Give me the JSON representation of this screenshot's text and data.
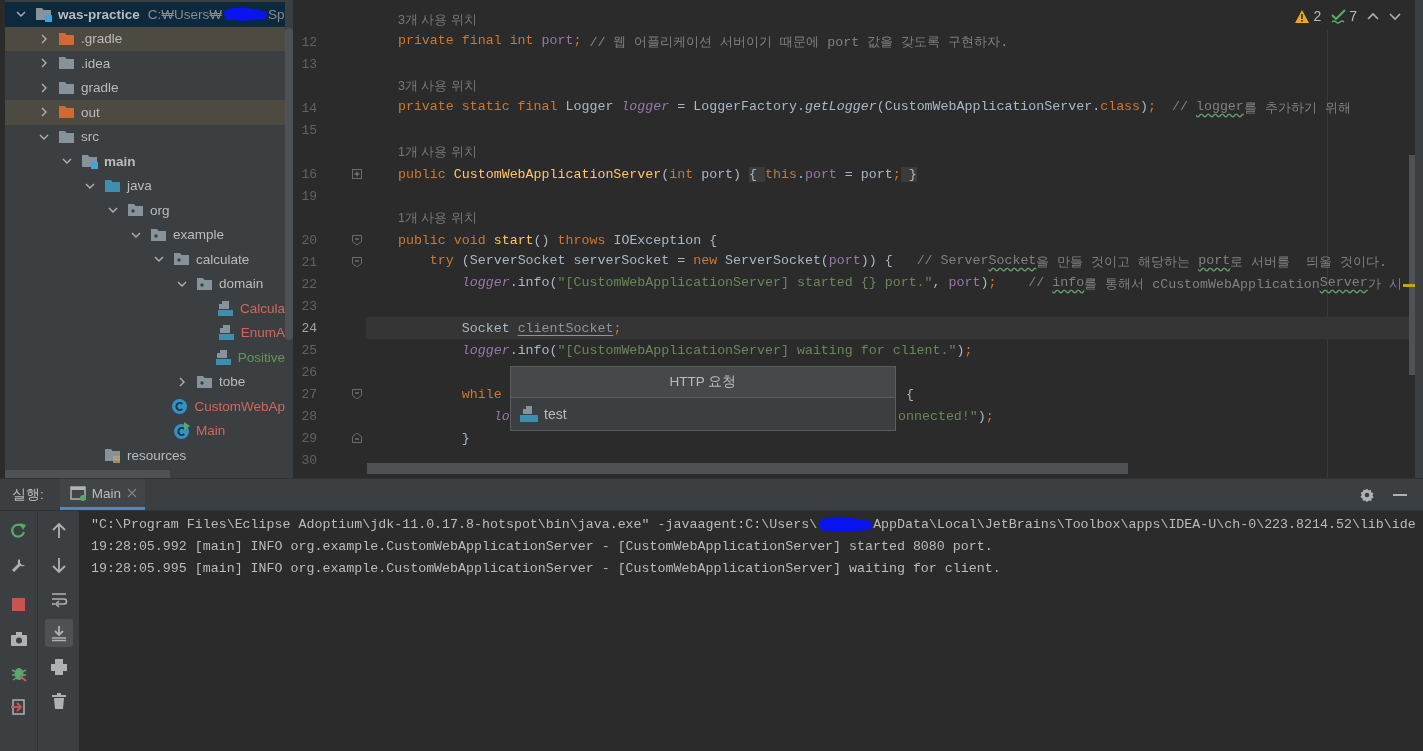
{
  "project_tree": {
    "root": {
      "name": "was-practice",
      "path": "C:₩Users₩",
      "redacted": true,
      "path_end": "Sp",
      "kind": "module",
      "expanded": true,
      "selected": true,
      "children": [
        {
          "name": ".gradle",
          "kind": "excluded-folder",
          "expanded": false,
          "selected": false
        },
        {
          "name": ".idea",
          "kind": "folder",
          "expanded": false,
          "selected": false
        },
        {
          "name": "gradle",
          "kind": "folder",
          "expanded": false,
          "selected": false
        },
        {
          "name": "out",
          "kind": "excluded-folder",
          "expanded": false,
          "selected": false
        },
        {
          "name": "src",
          "kind": "folder",
          "expanded": true,
          "selected": false,
          "children": [
            {
              "name": "main",
              "kind": "module-folder",
              "expanded": true,
              "selected": false,
              "children": [
                {
                  "name": "java",
                  "kind": "source-root",
                  "expanded": true,
                  "selected": false,
                  "children": [
                    {
                      "name": "org",
                      "kind": "package",
                      "expanded": true,
                      "selected": false,
                      "children": [
                        {
                          "name": "example",
                          "kind": "package",
                          "expanded": true,
                          "selected": false,
                          "children": [
                            {
                              "name": "calculate",
                              "kind": "package",
                              "expanded": true,
                              "selected": false,
                              "children": [
                                {
                                  "name": "domain",
                                  "kind": "package",
                                  "expanded": true,
                                  "selected": false,
                                  "children": [
                                    {
                                      "name": "Calcula",
                                      "kind": "java-file",
                                      "color": "#d1675a",
                                      "selected": false
                                    },
                                    {
                                      "name": "EnumA",
                                      "kind": "java-file",
                                      "color": "#d1675a",
                                      "selected": false
                                    },
                                    {
                                      "name": "Positive",
                                      "kind": "java-file",
                                      "color": "#629755",
                                      "selected": false
                                    }
                                  ]
                                },
                                {
                                  "name": "tobe",
                                  "kind": "package",
                                  "expanded": false,
                                  "selected": false
                                }
                              ]
                            },
                            {
                              "name": "CustomWebAp",
                              "kind": "class",
                              "color": "#d1675a",
                              "selected": false
                            },
                            {
                              "name": "Main",
                              "kind": "main-class",
                              "color": "#d1675a",
                              "selected": false
                            }
                          ]
                        }
                      ]
                    }
                  ]
                },
                {
                  "name": "resources",
                  "kind": "resources-root",
                  "selected": false
                }
              ]
            }
          ]
        }
      ]
    }
  },
  "editor": {
    "inspections": [
      {
        "kind": "warning",
        "count": "2"
      },
      {
        "kind": "typo",
        "count": "7"
      }
    ],
    "rows": [
      {
        "kind": "hint",
        "text": "    3개 사용 위치"
      },
      {
        "kind": "code",
        "number": "12",
        "current": false,
        "tokens": [
          {
            "kind": "kw",
            "text": "    private final int "
          },
          {
            "kind": "field",
            "text": "port"
          },
          {
            "kind": "kw",
            "text": ";"
          },
          {
            "kind": "comment",
            "text": " // 웹 어플리케이션 서버이기 때문에 port 값을 갖도록 구현하자."
          }
        ]
      },
      {
        "kind": "code",
        "number": "13",
        "current": false,
        "tokens": []
      },
      {
        "kind": "hint",
        "text": "    3개 사용 위치"
      },
      {
        "kind": "code",
        "number": "14",
        "current": false,
        "tokens": [
          {
            "kind": "kw",
            "text": "    private static final "
          },
          {
            "kind": "plain",
            "text": "Logger "
          },
          {
            "kind": "static",
            "text": "logger"
          },
          {
            "kind": "plain",
            "text": " = LoggerFactory."
          },
          {
            "kind": "static-method",
            "text": "getLogger"
          },
          {
            "kind": "plain",
            "text": "(CustomWebApplicationServer."
          },
          {
            "kind": "kw",
            "text": "class"
          },
          {
            "kind": "plain",
            "text": ")"
          },
          {
            "kind": "kw",
            "text": ";"
          },
          {
            "kind": "comment",
            "text": "  // "
          },
          {
            "kind": "typo",
            "text": "logger"
          },
          {
            "kind": "comment",
            "text": "를 추가하기 위해"
          }
        ]
      },
      {
        "kind": "code",
        "number": "15",
        "current": false,
        "tokens": []
      },
      {
        "kind": "hint",
        "text": "    1개 사용 위치"
      },
      {
        "kind": "code",
        "number": "16",
        "current": false,
        "fold": {
          "kind": "collapsed"
        },
        "tokens": [
          {
            "kind": "kw",
            "text": "    public "
          },
          {
            "kind": "method",
            "text": "CustomWebApplicationServer"
          },
          {
            "kind": "plain",
            "text": "("
          },
          {
            "kind": "kw",
            "text": "int"
          },
          {
            "kind": "plain",
            "text": " port) "
          },
          {
            "kind": "folded",
            "text": "{ "
          },
          {
            "kind": "kw",
            "text": "this"
          },
          {
            "kind": "plain",
            "text": "."
          },
          {
            "kind": "field",
            "text": "port"
          },
          {
            "kind": "plain",
            "text": " = port"
          },
          {
            "kind": "kw",
            "text": ";"
          },
          {
            "kind": "folded",
            "text": " }"
          }
        ]
      },
      {
        "kind": "code",
        "number": "19",
        "current": false,
        "tokens": []
      },
      {
        "kind": "hint",
        "text": "    1개 사용 위치"
      },
      {
        "kind": "code",
        "number": "20",
        "current": false,
        "fold": {
          "kind": "start"
        },
        "tokens": [
          {
            "kind": "kw",
            "text": "    public void "
          },
          {
            "kind": "method",
            "text": "start"
          },
          {
            "kind": "plain",
            "text": "() "
          },
          {
            "kind": "kw",
            "text": "throws"
          },
          {
            "kind": "plain",
            "text": " IOException {"
          }
        ]
      },
      {
        "kind": "code",
        "number": "21",
        "current": false,
        "fold": {
          "kind": "start"
        },
        "tokens": [
          {
            "kind": "kw",
            "text": "        try"
          },
          {
            "kind": "plain",
            "text": " (ServerSocket serverSocket = "
          },
          {
            "kind": "kw",
            "text": "new"
          },
          {
            "kind": "plain",
            "text": " ServerSocket("
          },
          {
            "kind": "field",
            "text": "port"
          },
          {
            "kind": "plain",
            "text": ")) {"
          },
          {
            "kind": "comment",
            "text": "   // Server"
          },
          {
            "kind": "typo",
            "text": "Socket"
          },
          {
            "kind": "comment",
            "text": "을 만들 것이고 해당하는 "
          },
          {
            "kind": "typo",
            "text": "port"
          },
          {
            "kind": "comment",
            "text": "로 서버를  띄울 것이다."
          }
        ]
      },
      {
        "kind": "code",
        "number": "22",
        "current": false,
        "tokens": [
          {
            "kind": "static",
            "text": "            logger"
          },
          {
            "kind": "plain",
            "text": ".info("
          },
          {
            "kind": "str",
            "text": "\"[CustomWebApplicationServer] started {} port.\""
          },
          {
            "kind": "plain",
            "text": ", "
          },
          {
            "kind": "field",
            "text": "port"
          },
          {
            "kind": "plain",
            "text": ")"
          },
          {
            "kind": "kw",
            "text": ";"
          },
          {
            "kind": "comment",
            "text": "    // "
          },
          {
            "kind": "typo",
            "text": "info"
          },
          {
            "kind": "comment",
            "text": "를 통해서 cCustomWebApplication"
          },
          {
            "kind": "typo",
            "text": "Server"
          },
          {
            "kind": "comment",
            "text": "가 시"
          }
        ]
      },
      {
        "kind": "code",
        "number": "23",
        "current": false,
        "tokens": []
      },
      {
        "kind": "code",
        "number": "24",
        "current": true,
        "tokens": [
          {
            "kind": "plain",
            "text": "            Socket "
          },
          {
            "kind": "unused",
            "text": "clientSocket"
          },
          {
            "kind": "kw",
            "text": ";"
          }
        ]
      },
      {
        "kind": "code",
        "number": "25",
        "current": false,
        "tokens": [
          {
            "kind": "static",
            "text": "            logger"
          },
          {
            "kind": "plain",
            "text": ".info("
          },
          {
            "kind": "str",
            "text": "\"[CustomWebApplicationServer] waiting for client.\""
          },
          {
            "kind": "plain",
            "text": ")"
          },
          {
            "kind": "kw",
            "text": ";"
          }
        ]
      },
      {
        "kind": "code",
        "number": "26",
        "current": false,
        "tokens": []
      },
      {
        "kind": "code",
        "number": "27",
        "current": false,
        "fold": {
          "kind": "start"
        },
        "tokens": [
          {
            "kind": "kw",
            "text": "            while"
          }
        ],
        "tokens_after": [
          {
            "kind": "plain",
            "text": " {"
          }
        ]
      },
      {
        "kind": "code",
        "number": "28",
        "current": false,
        "tokens": [
          {
            "kind": "static",
            "text": "                lo"
          }
        ],
        "tokens_after": [
          {
            "kind": "str",
            "text": "onnected!\""
          },
          {
            "kind": "plain",
            "text": ")"
          },
          {
            "kind": "kw",
            "text": ";"
          }
        ]
      },
      {
        "kind": "code",
        "number": "29",
        "current": false,
        "fold": {
          "kind": "end"
        },
        "tokens": [
          {
            "kind": "plain",
            "text": "            }"
          }
        ]
      },
      {
        "kind": "code",
        "number": "30",
        "current": false,
        "tokens": []
      }
    ],
    "popup": {
      "title": "HTTP 요청",
      "value": "test"
    }
  },
  "run_panel": {
    "label": "실행:",
    "tabs": [
      {
        "label": "Main",
        "selected": true
      }
    ],
    "toolbars": [
      [
        [
          {
            "kind": "rerun",
            "on": false
          },
          {
            "kind": "settings",
            "on": false
          }
        ],
        [
          {
            "kind": "stop",
            "on": false
          },
          {
            "kind": "camera",
            "on": false
          },
          {
            "kind": "debug",
            "on": false
          },
          {
            "kind": "exit",
            "on": false
          }
        ]
      ],
      [
        [
          {
            "kind": "up",
            "on": false
          },
          {
            "kind": "down",
            "on": false
          },
          {
            "kind": "wrap",
            "on": false
          },
          {
            "kind": "scroll-end",
            "on": true
          },
          {
            "kind": "print",
            "on": false
          },
          {
            "kind": "trash",
            "on": false
          }
        ]
      ]
    ],
    "console": [
      {
        "segments": [
          {
            "kind": "text",
            "text": "\"C:\\Program Files\\Eclipse Adoptium\\jdk-11.0.17.8-hotspot\\bin\\java.exe\" -javaagent:C:\\Users\\"
          },
          {
            "kind": "redaction"
          },
          {
            "kind": "text",
            "text": "AppData\\Local\\JetBrains\\Toolbox\\apps\\IDEA-U\\ch-0\\223.8214.52\\lib\\ide"
          }
        ]
      },
      {
        "segments": [
          {
            "kind": "text",
            "text": "19:28:05.992 [main] INFO org.example.CustomWebApplicationServer - [CustomWebApplicationServer] started 8080 port."
          }
        ]
      },
      {
        "segments": [
          {
            "kind": "text",
            "text": "19:28:05.995 [main] INFO org.example.CustomWebApplicationServer - [CustomWebApplicationServer] waiting for client."
          }
        ]
      }
    ]
  }
}
